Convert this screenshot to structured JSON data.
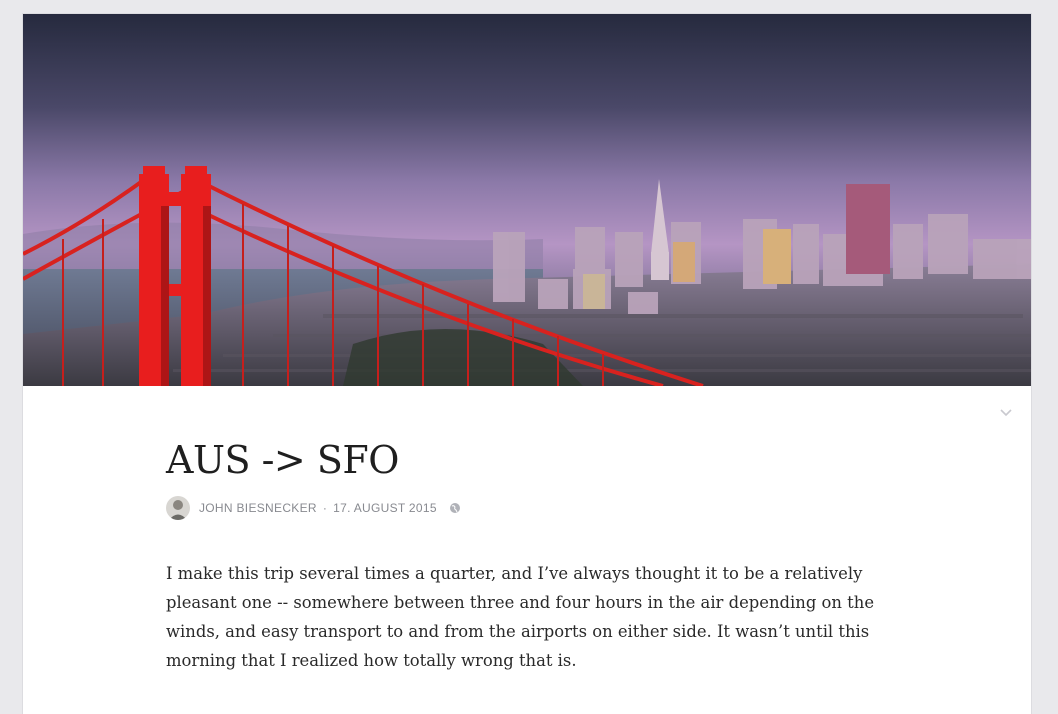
{
  "hero": {
    "image": "golden-gate-bridge-san-francisco-skyline-photo",
    "colors": {
      "sky_top": "#2b2f45",
      "sky_mid": "#7a6a9a",
      "sky_glow": "#c79bc8",
      "bridge": "#e81e1e"
    }
  },
  "post": {
    "title": "AUS -> SFO",
    "author": "JOHN BIESNECKER",
    "separator": "·",
    "date": "17. AUGUST 2015",
    "visibility_icon": "globe-icon",
    "expand_icon": "chevron-down-icon",
    "body": "I make this trip several times a quarter, and I’ve always thought it to be a relatively pleasant one -- somewhere between three and four hours in the air depending on the winds, and easy transport to and from the airports on either side. It wasn’t until this morning that I realized how totally wrong that is."
  }
}
